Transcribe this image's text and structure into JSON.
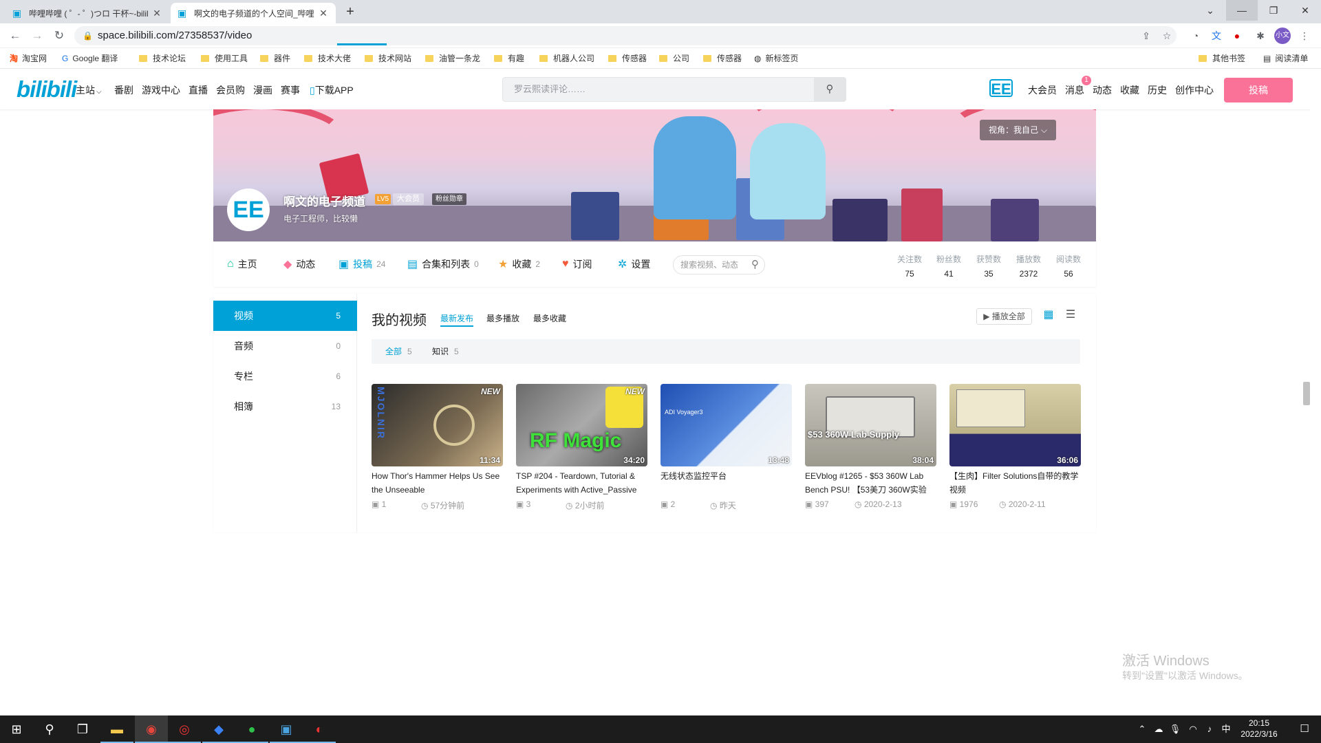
{
  "browser": {
    "tabs": [
      {
        "title": "哔哩哔哩 ( ゜- ゜)つロ 干杯~-bilil",
        "active": false
      },
      {
        "title": "啊文的电子频道的个人空间_哔哩",
        "active": true
      }
    ],
    "new_tab": "+",
    "url": "space.bilibili.com/27358537/video",
    "bookmarks": [
      "淘宝网",
      "Google 翻译",
      "技术论坛",
      "使用工具",
      "器件",
      "技术大佬",
      "技术网站",
      "油管一条龙",
      "有趣",
      "机器人公司",
      "传感器",
      "公司",
      "传感器",
      "新标签页"
    ],
    "bookmarks_right": [
      "其他书签",
      "阅读清单"
    ]
  },
  "header": {
    "logo": "bilibili",
    "nav": [
      "主站",
      "番剧",
      "游戏中心",
      "直播",
      "会员购",
      "漫画",
      "赛事",
      "下载APP"
    ],
    "search_placeholder": "罗云熙读评论……",
    "right": [
      "大会员",
      "消息",
      "动态",
      "收藏",
      "历史",
      "创作中心"
    ],
    "msg_badge": "1",
    "upload": "投稿"
  },
  "profile": {
    "view_selector": "视角：我自己",
    "avatar_text": "EE",
    "name": "啊文的电子频道",
    "level": "LV5",
    "vip": "大会员",
    "medal": "粉丝勋章",
    "sign": "电子工程师，比较懒"
  },
  "profile_nav": {
    "items": [
      {
        "label": "主页",
        "count": ""
      },
      {
        "label": "动态",
        "count": ""
      },
      {
        "label": "投稿",
        "count": "24"
      },
      {
        "label": "合集和列表",
        "count": "0"
      },
      {
        "label": "收藏",
        "count": "2"
      },
      {
        "label": "订阅",
        "count": ""
      },
      {
        "label": "设置",
        "count": ""
      }
    ],
    "search_placeholder": "搜索视频、动态",
    "stats": [
      {
        "label": "关注数",
        "value": "75"
      },
      {
        "label": "粉丝数",
        "value": "41"
      },
      {
        "label": "获赞数",
        "value": "35"
      },
      {
        "label": "播放数",
        "value": "2372"
      },
      {
        "label": "阅读数",
        "value": "56"
      }
    ]
  },
  "sidebar": [
    {
      "label": "视频",
      "count": "5"
    },
    {
      "label": "音频",
      "count": "0"
    },
    {
      "label": "专栏",
      "count": "6"
    },
    {
      "label": "相簿",
      "count": "13"
    }
  ],
  "videos_section": {
    "title": "我的视频",
    "sorts": [
      "最新发布",
      "最多播放",
      "最多收藏"
    ],
    "play_all": "播放全部",
    "filters": [
      {
        "label": "全部",
        "count": "5"
      },
      {
        "label": "知识",
        "count": "5"
      }
    ]
  },
  "videos": [
    {
      "title": "How Thor's Hammer Helps Us See the Unseeable",
      "duration": "11:34",
      "badge": "NEW",
      "plays": "1",
      "time": "57分钟前",
      "thumb_text": "MJOLNIR"
    },
    {
      "title": "TSP #204 - Teardown, Tutorial & Experiments with Active_Passive",
      "duration": "34:20",
      "badge": "NEW",
      "plays": "3",
      "time": "2小时前",
      "thumb_text": "RF Magic"
    },
    {
      "title": "无线状态监控平台",
      "duration": "13:48",
      "badge": "",
      "plays": "2",
      "time": "昨天",
      "thumb_text": "ADI Voyager3"
    },
    {
      "title": "EEVblog #1265 - $53 360W Lab Bench PSU! 【53美刀 360W实验",
      "duration": "38:04",
      "badge": "",
      "plays": "397",
      "time": "2020-2-13",
      "thumb_text": "$53 360W Lab Supply"
    },
    {
      "title": "【生肉】Filter Solutions自带的教学视频",
      "duration": "36:06",
      "badge": "",
      "plays": "1976",
      "time": "2020-2-11",
      "thumb_text": ""
    }
  ],
  "watermark": {
    "line1": "激活 Windows",
    "line2": "转到\"设置\"以激活 Windows。"
  },
  "taskbar": {
    "time": "20:15",
    "date": "2022/3/16",
    "ime": "中"
  },
  "colors": {
    "accent": "#00a1d6",
    "pink": "#fb7299"
  }
}
